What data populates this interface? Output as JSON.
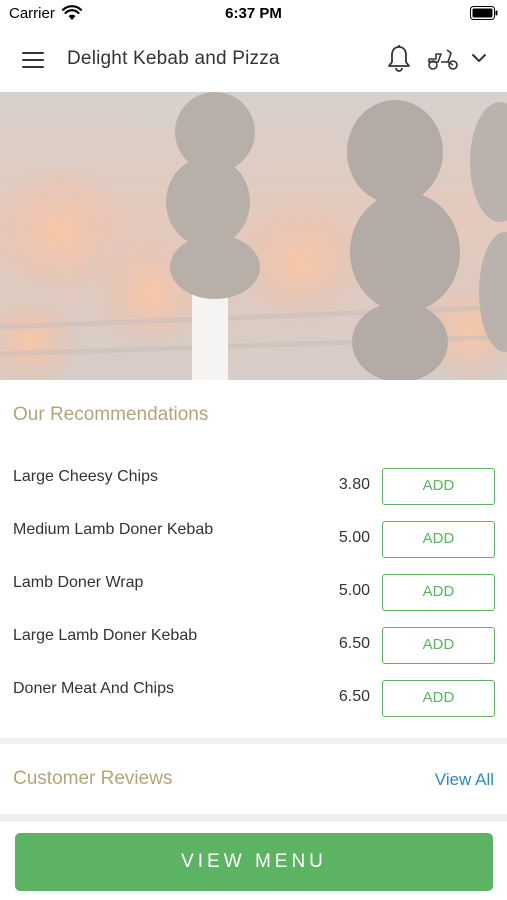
{
  "status_bar": {
    "carrier": "Carrier",
    "time": "6:37 PM"
  },
  "header": {
    "title": "Delight Kebab and Pizza",
    "icons": [
      "menu-icon",
      "bell-icon",
      "scooter-icon",
      "chevron-down-icon"
    ]
  },
  "recommendations": {
    "title": "Our Recommendations",
    "add_label": "ADD",
    "items": [
      {
        "name": "Large Cheesy Chips",
        "price": "3.80"
      },
      {
        "name": "Medium Lamb Doner Kebab",
        "price": "5.00"
      },
      {
        "name": "Lamb Doner Wrap",
        "price": "5.00"
      },
      {
        "name": "Large Lamb Doner Kebab",
        "price": "6.50"
      },
      {
        "name": "Doner Meat And Chips",
        "price": "6.50"
      }
    ]
  },
  "reviews": {
    "title": "Customer Reviews",
    "view_all": "View All"
  },
  "footer": {
    "view_menu": "VIEW MENU"
  },
  "colors": {
    "accent_green": "#5cb363",
    "section_title": "#b3a57a",
    "link_blue": "#2f8bb8"
  }
}
